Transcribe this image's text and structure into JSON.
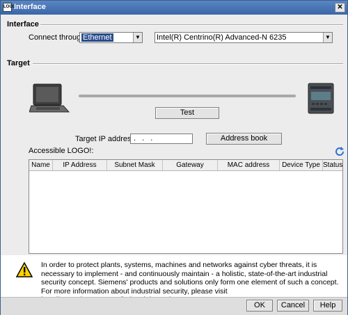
{
  "window": {
    "title": "Interface",
    "logo_text": "LOGO"
  },
  "interface": {
    "section_title": "Interface",
    "connect_label": "Connect through:",
    "connect_value": "Ethernet",
    "adapter_value": "Intel(R) Centrino(R) Advanced-N 6235"
  },
  "target": {
    "section_title": "Target",
    "test_label": "Test",
    "ip_label": "Target IP address:",
    "ip_value": ".  .  .",
    "address_book_label": "Address book",
    "accessible_label": "Accessible LOGO!:"
  },
  "table": {
    "columns": [
      "Name",
      "IP Address",
      "Subnet Mask",
      "Gateway",
      "MAC address",
      "Device Type",
      "Status"
    ],
    "rows": []
  },
  "warning": {
    "text": "In order to protect plants, systems, machines and networks against cyber threats, it is necessary to implement - and continuously maintain - a holistic, state-of-the-art industrial security concept. Siemens' products and solutions only form one element of such a concept. For more information about industrial security, please visit http://www.siemens.com/industrialsecurity."
  },
  "buttons": {
    "ok": "OK",
    "cancel": "Cancel",
    "help": "Help"
  },
  "icons": {
    "laptop": "laptop-icon",
    "device": "logo-device-icon",
    "refresh": "refresh-icon",
    "warning": "warning-icon",
    "close": "close-icon"
  },
  "colors": {
    "titlebar": "#3a66a8",
    "selection": "#2a4d8c",
    "refresh": "#2f6fd0",
    "warning": "#ffd200"
  }
}
